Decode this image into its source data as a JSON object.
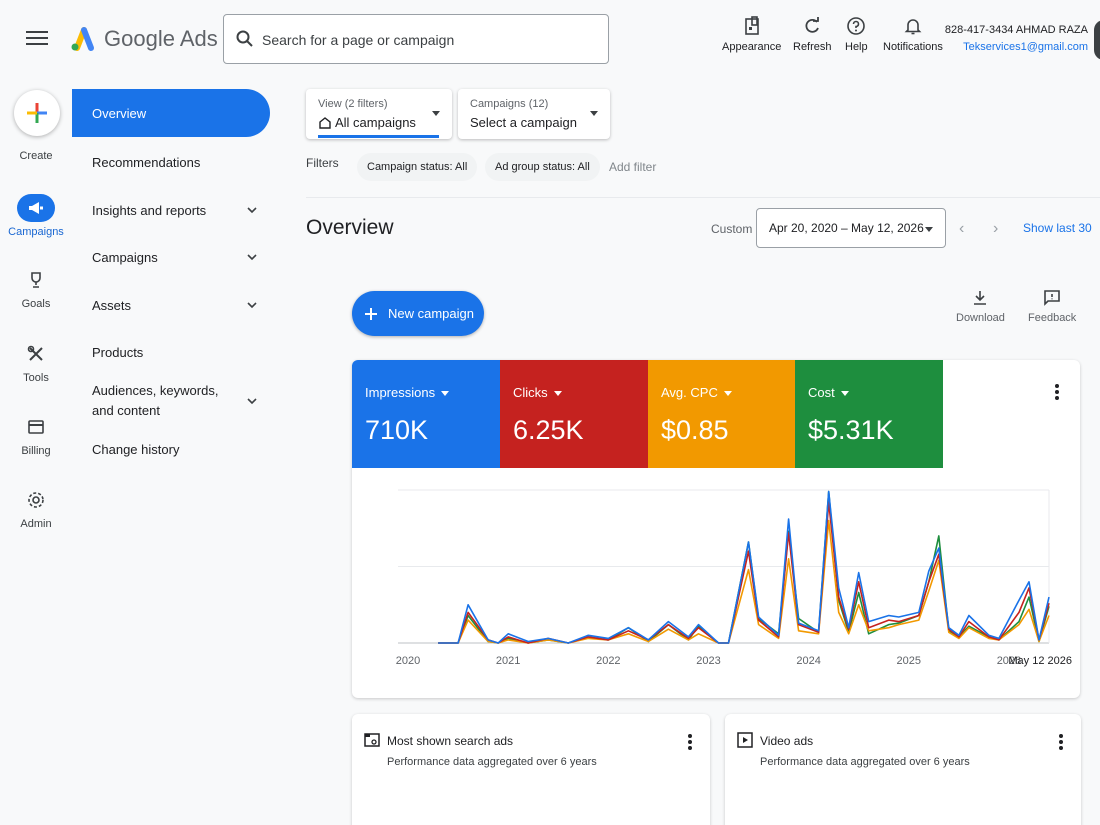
{
  "header": {
    "brand": "Google Ads",
    "search_placeholder": "Search for a page or campaign",
    "tools": [
      {
        "label": "Appearance",
        "icon": "appearance-icon"
      },
      {
        "label": "Refresh",
        "icon": "refresh-icon"
      },
      {
        "label": "Help",
        "icon": "help-icon"
      },
      {
        "label": "Notifications",
        "icon": "notifications-icon"
      }
    ],
    "account_phone_name": "828-417-3434 AHMAD RAZA",
    "account_email": "Tekservices1@gmail.com"
  },
  "rail": {
    "items": [
      {
        "label": "Create",
        "icon": "create-plus-icon"
      },
      {
        "label": "Campaigns",
        "icon": "megaphone-icon",
        "active": true
      },
      {
        "label": "Goals",
        "icon": "trophy-icon"
      },
      {
        "label": "Tools",
        "icon": "tools-icon"
      },
      {
        "label": "Billing",
        "icon": "billing-card-icon"
      },
      {
        "label": "Admin",
        "icon": "gear-icon"
      }
    ]
  },
  "sidenav": {
    "items": [
      {
        "label": "Overview",
        "active": true
      },
      {
        "label": "Recommendations"
      },
      {
        "label": "Insights and reports",
        "expandable": true
      },
      {
        "label": "Campaigns",
        "expandable": true
      },
      {
        "label": "Assets",
        "expandable": true
      },
      {
        "label": "Products"
      },
      {
        "label": "Audiences, keywords, and content",
        "expandable": true
      },
      {
        "label": "Change history"
      }
    ]
  },
  "selectors": {
    "view_label": "View (2 filters)",
    "view_value": "All campaigns",
    "campaigns_label": "Campaigns (12)",
    "campaigns_value": "Select a campaign"
  },
  "filters": {
    "label": "Filters",
    "chips": [
      "Campaign status: All",
      "Ad group status: All"
    ],
    "add_filter": "Add filter"
  },
  "overview": {
    "title": "Overview",
    "date_mode": "Custom",
    "date_range": "Apr 20, 2020 – May 12, 2026",
    "show_last": "Show last 30",
    "new_campaign": "New campaign",
    "download": "Download",
    "feedback": "Feedback"
  },
  "metrics": [
    {
      "label": "Impressions",
      "value": "710K",
      "color": "#1a73e8"
    },
    {
      "label": "Clicks",
      "value": "6.25K",
      "color": "#c5221f"
    },
    {
      "label": "Avg. CPC",
      "value": "$0.85",
      "color": "#f29900"
    },
    {
      "label": "Cost",
      "value": "$5.31K",
      "color": "#1e8e3e"
    }
  ],
  "chart_data": {
    "type": "line",
    "x": [
      2020.3,
      2020.5,
      2020.6,
      2020.8,
      2020.9,
      2021.0,
      2021.2,
      2021.4,
      2021.6,
      2021.8,
      2022.0,
      2022.2,
      2022.4,
      2022.6,
      2022.8,
      2022.9,
      2023.1,
      2023.2,
      2023.4,
      2023.5,
      2023.7,
      2023.8,
      2023.9,
      2024.1,
      2024.2,
      2024.3,
      2024.4,
      2024.5,
      2024.6,
      2024.8,
      2024.9,
      2025.1,
      2025.2,
      2025.3,
      2025.4,
      2025.5,
      2025.6,
      2025.8,
      2025.9,
      2026.1,
      2026.2,
      2026.3,
      2026.4
    ],
    "x_tick_labels": [
      "2020",
      "2021",
      "2022",
      "2023",
      "2024",
      "2025",
      "2026",
      "May 12 2026"
    ],
    "series": [
      {
        "color": "#1a73e8",
        "values": [
          0,
          0,
          25,
          2,
          0,
          6,
          1,
          3,
          0,
          5,
          3,
          10,
          2,
          14,
          4,
          12,
          0,
          0,
          66,
          17,
          5,
          81,
          13,
          8,
          99,
          36,
          10,
          46,
          14,
          18,
          17,
          20,
          47,
          62,
          10,
          5,
          18,
          5,
          3,
          28,
          40,
          2,
          30
        ]
      },
      {
        "color": "#c5221f",
        "values": [
          0,
          0,
          20,
          2,
          0,
          4,
          0,
          3,
          0,
          4,
          2,
          8,
          2,
          12,
          3,
          10,
          0,
          0,
          60,
          15,
          4,
          72,
          12,
          7,
          92,
          30,
          9,
          40,
          10,
          15,
          14,
          18,
          40,
          58,
          9,
          4,
          14,
          4,
          2,
          20,
          36,
          2,
          26
        ]
      },
      {
        "color": "#f29900",
        "values": [
          0,
          0,
          15,
          1,
          0,
          2,
          0,
          2,
          0,
          3,
          2,
          6,
          1,
          9,
          2,
          6,
          0,
          0,
          48,
          12,
          3,
          55,
          8,
          6,
          80,
          20,
          6,
          25,
          8,
          10,
          12,
          15,
          34,
          54,
          7,
          3,
          10,
          3,
          2,
          12,
          22,
          1,
          18
        ]
      },
      {
        "color": "#1e8e3e",
        "values": [
          0,
          0,
          18,
          1,
          0,
          3,
          0,
          2,
          0,
          4,
          2,
          10,
          1,
          12,
          2,
          11,
          0,
          0,
          66,
          16,
          6,
          73,
          16,
          7,
          99,
          28,
          7,
          33,
          6,
          12,
          13,
          18,
          40,
          70,
          8,
          4,
          11,
          4,
          2,
          14,
          30,
          1,
          24
        ]
      }
    ],
    "ylim": [
      0,
      100
    ],
    "xlim": [
      2019.9,
      2026.4
    ],
    "grid": true
  },
  "bottom_cards": [
    {
      "title": "Most shown search ads",
      "subtitle": "Performance data aggregated over 6 years",
      "icon": "search-ads-icon"
    },
    {
      "title": "Video ads",
      "subtitle": "Performance data aggregated over 6 years",
      "icon": "video-ads-icon"
    }
  ]
}
